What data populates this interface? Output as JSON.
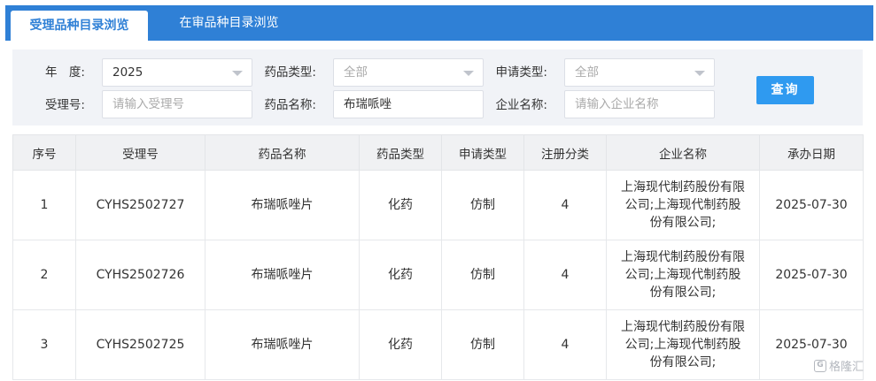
{
  "tabs": [
    {
      "label": "受理品种目录浏览",
      "active": true
    },
    {
      "label": "在审品种目录浏览",
      "active": false
    }
  ],
  "filters": {
    "year": {
      "label": "年　度:",
      "value": "2025"
    },
    "drug_type": {
      "label": "药品类型:",
      "value": "全部"
    },
    "apply_type": {
      "label": "申请类型:",
      "value": "全部"
    },
    "accept_no": {
      "label": "受理号:",
      "placeholder": "请输入受理号"
    },
    "drug_name": {
      "label": "药品名称:",
      "value": "布瑞哌唑"
    },
    "company": {
      "label": "企业名称:",
      "placeholder": "请输入企业名称"
    },
    "query_label": "查询"
  },
  "table": {
    "headers": [
      "序号",
      "受理号",
      "药品名称",
      "药品类型",
      "申请类型",
      "注册分类",
      "企业名称",
      "承办日期"
    ],
    "rows": [
      [
        "1",
        "CYHS2502727",
        "布瑞哌唑片",
        "化药",
        "仿制",
        "4",
        "上海现代制药股份有限公司;上海现代制药股份有限公司;",
        "2025-07-30"
      ],
      [
        "2",
        "CYHS2502726",
        "布瑞哌唑片",
        "化药",
        "仿制",
        "4",
        "上海现代制药股份有限公司;上海现代制药股份有限公司;",
        "2025-07-30"
      ],
      [
        "3",
        "CYHS2502725",
        "布瑞哌唑片",
        "化药",
        "仿制",
        "4",
        "上海现代制药股份有限公司;上海现代制药股份有限公司;",
        "2025-07-30"
      ]
    ]
  },
  "watermark": {
    "logo": "G",
    "text": "格隆汇"
  },
  "colors": {
    "primary": "#2f80d6",
    "button": "#2f9af0",
    "panel": "#f1f3f7"
  }
}
